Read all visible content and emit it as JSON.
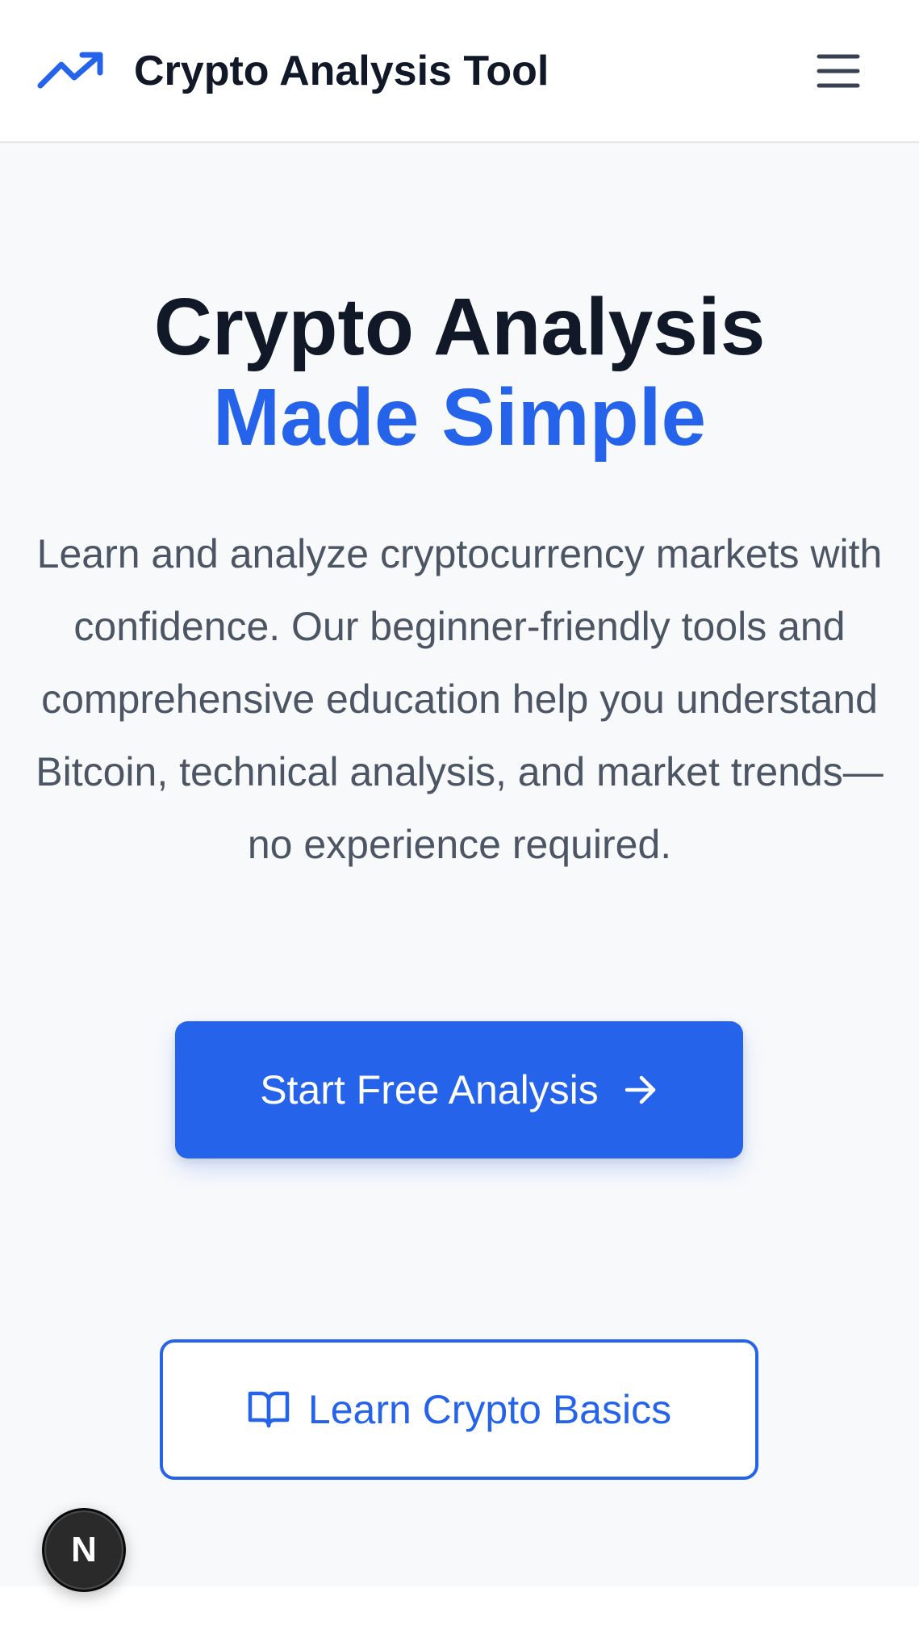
{
  "header": {
    "title": "Crypto Analysis Tool",
    "logo_icon": "trending-up-icon",
    "menu_icon": "hamburger-menu-icon"
  },
  "hero": {
    "title_line1": "Crypto Analysis",
    "title_line2": "Made Simple",
    "description": "Learn and analyze cryptocurrency markets with confidence. Our beginner-friendly tools and comprehensive education help you understand Bitcoin, technical analysis, and market trends—no experience required.",
    "primary_button": {
      "label": "Start Free Analysis",
      "icon": "arrow-right-icon"
    },
    "secondary_button": {
      "label": "Learn Crypto Basics",
      "icon": "book-open-icon"
    }
  },
  "dev_badge": {
    "letter": "N"
  },
  "colors": {
    "accent": "#2563eb",
    "heading": "#111827",
    "body_text": "#4b5563",
    "background": "#f8f9fb"
  }
}
